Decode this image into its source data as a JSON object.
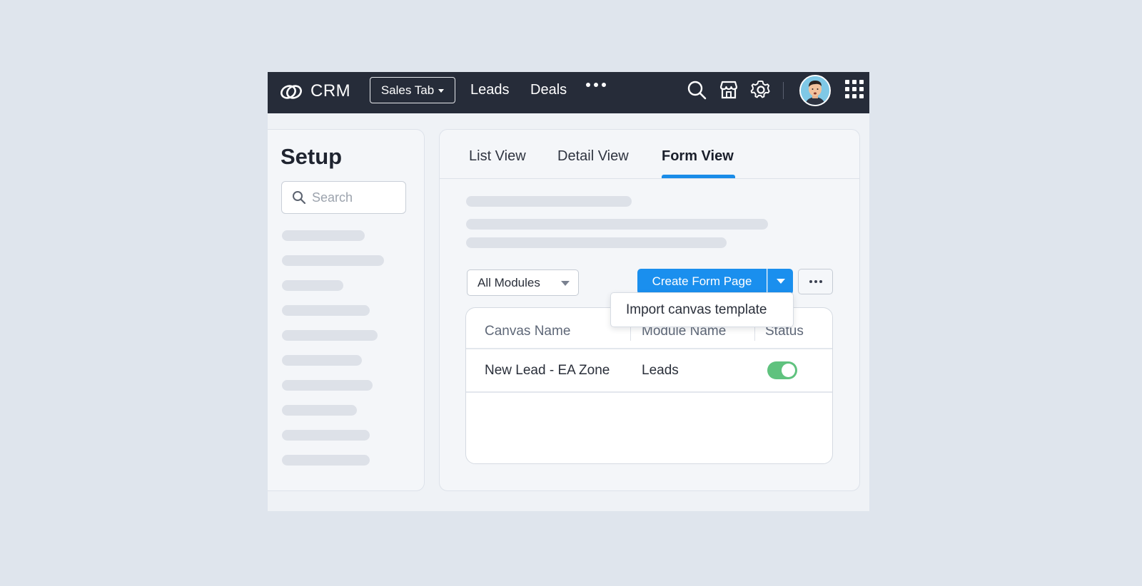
{
  "header": {
    "app_name": "CRM",
    "sales_tab_label": "Sales Tab",
    "nav": [
      "Leads",
      "Deals"
    ],
    "icons": [
      "logo-icon",
      "more-icon",
      "search-icon",
      "marketplace-icon",
      "gear-icon",
      "avatar",
      "apps-grid-icon"
    ]
  },
  "sidebar": {
    "title": "Setup",
    "search_placeholder": "Search"
  },
  "main": {
    "tabs": [
      {
        "label": "List View",
        "active": false
      },
      {
        "label": "Detail View",
        "active": false
      },
      {
        "label": "Form View",
        "active": true
      }
    ],
    "modules_select": "All Modules",
    "create_button": "Create Form Page",
    "dropdown_item": "Import canvas template",
    "table": {
      "headers": [
        "Canvas Name",
        "Module Name",
        "Status"
      ],
      "rows": [
        {
          "canvas_name": "New Lead - EA Zone",
          "module_name": "Leads",
          "status_enabled": true
        }
      ]
    }
  },
  "colors": {
    "topbar": "#262c39",
    "accent": "#1a8fee",
    "toggle_on": "#5fc27e",
    "background": "#dfe5ed"
  }
}
